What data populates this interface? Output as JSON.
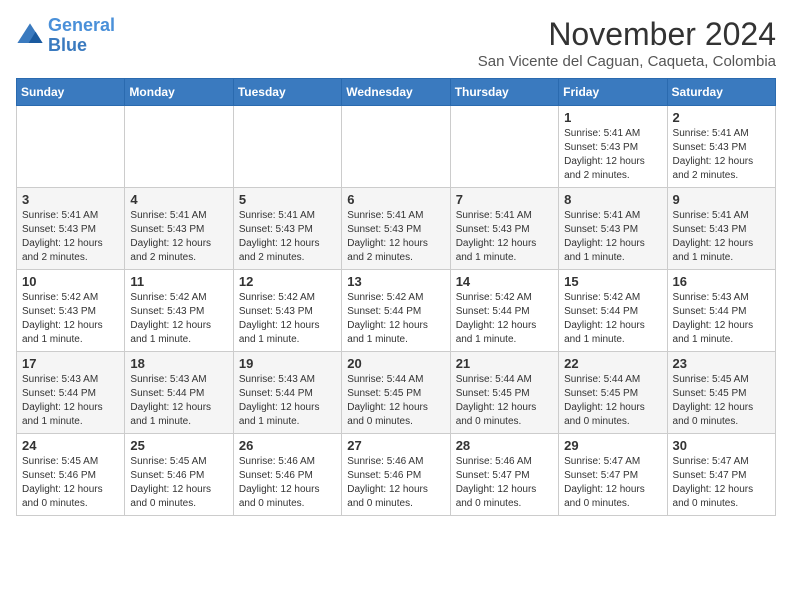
{
  "logo": {
    "line1": "General",
    "line2": "Blue"
  },
  "title": "November 2024",
  "location": "San Vicente del Caguan, Caqueta, Colombia",
  "weekdays": [
    "Sunday",
    "Monday",
    "Tuesday",
    "Wednesday",
    "Thursday",
    "Friday",
    "Saturday"
  ],
  "weeks": [
    [
      {
        "day": "",
        "info": ""
      },
      {
        "day": "",
        "info": ""
      },
      {
        "day": "",
        "info": ""
      },
      {
        "day": "",
        "info": ""
      },
      {
        "day": "",
        "info": ""
      },
      {
        "day": "1",
        "info": "Sunrise: 5:41 AM\nSunset: 5:43 PM\nDaylight: 12 hours and 2 minutes."
      },
      {
        "day": "2",
        "info": "Sunrise: 5:41 AM\nSunset: 5:43 PM\nDaylight: 12 hours and 2 minutes."
      }
    ],
    [
      {
        "day": "3",
        "info": "Sunrise: 5:41 AM\nSunset: 5:43 PM\nDaylight: 12 hours and 2 minutes."
      },
      {
        "day": "4",
        "info": "Sunrise: 5:41 AM\nSunset: 5:43 PM\nDaylight: 12 hours and 2 minutes."
      },
      {
        "day": "5",
        "info": "Sunrise: 5:41 AM\nSunset: 5:43 PM\nDaylight: 12 hours and 2 minutes."
      },
      {
        "day": "6",
        "info": "Sunrise: 5:41 AM\nSunset: 5:43 PM\nDaylight: 12 hours and 2 minutes."
      },
      {
        "day": "7",
        "info": "Sunrise: 5:41 AM\nSunset: 5:43 PM\nDaylight: 12 hours and 1 minute."
      },
      {
        "day": "8",
        "info": "Sunrise: 5:41 AM\nSunset: 5:43 PM\nDaylight: 12 hours and 1 minute."
      },
      {
        "day": "9",
        "info": "Sunrise: 5:41 AM\nSunset: 5:43 PM\nDaylight: 12 hours and 1 minute."
      }
    ],
    [
      {
        "day": "10",
        "info": "Sunrise: 5:42 AM\nSunset: 5:43 PM\nDaylight: 12 hours and 1 minute."
      },
      {
        "day": "11",
        "info": "Sunrise: 5:42 AM\nSunset: 5:43 PM\nDaylight: 12 hours and 1 minute."
      },
      {
        "day": "12",
        "info": "Sunrise: 5:42 AM\nSunset: 5:43 PM\nDaylight: 12 hours and 1 minute."
      },
      {
        "day": "13",
        "info": "Sunrise: 5:42 AM\nSunset: 5:44 PM\nDaylight: 12 hours and 1 minute."
      },
      {
        "day": "14",
        "info": "Sunrise: 5:42 AM\nSunset: 5:44 PM\nDaylight: 12 hours and 1 minute."
      },
      {
        "day": "15",
        "info": "Sunrise: 5:42 AM\nSunset: 5:44 PM\nDaylight: 12 hours and 1 minute."
      },
      {
        "day": "16",
        "info": "Sunrise: 5:43 AM\nSunset: 5:44 PM\nDaylight: 12 hours and 1 minute."
      }
    ],
    [
      {
        "day": "17",
        "info": "Sunrise: 5:43 AM\nSunset: 5:44 PM\nDaylight: 12 hours and 1 minute."
      },
      {
        "day": "18",
        "info": "Sunrise: 5:43 AM\nSunset: 5:44 PM\nDaylight: 12 hours and 1 minute."
      },
      {
        "day": "19",
        "info": "Sunrise: 5:43 AM\nSunset: 5:44 PM\nDaylight: 12 hours and 1 minute."
      },
      {
        "day": "20",
        "info": "Sunrise: 5:44 AM\nSunset: 5:45 PM\nDaylight: 12 hours and 0 minutes."
      },
      {
        "day": "21",
        "info": "Sunrise: 5:44 AM\nSunset: 5:45 PM\nDaylight: 12 hours and 0 minutes."
      },
      {
        "day": "22",
        "info": "Sunrise: 5:44 AM\nSunset: 5:45 PM\nDaylight: 12 hours and 0 minutes."
      },
      {
        "day": "23",
        "info": "Sunrise: 5:45 AM\nSunset: 5:45 PM\nDaylight: 12 hours and 0 minutes."
      }
    ],
    [
      {
        "day": "24",
        "info": "Sunrise: 5:45 AM\nSunset: 5:46 PM\nDaylight: 12 hours and 0 minutes."
      },
      {
        "day": "25",
        "info": "Sunrise: 5:45 AM\nSunset: 5:46 PM\nDaylight: 12 hours and 0 minutes."
      },
      {
        "day": "26",
        "info": "Sunrise: 5:46 AM\nSunset: 5:46 PM\nDaylight: 12 hours and 0 minutes."
      },
      {
        "day": "27",
        "info": "Sunrise: 5:46 AM\nSunset: 5:46 PM\nDaylight: 12 hours and 0 minutes."
      },
      {
        "day": "28",
        "info": "Sunrise: 5:46 AM\nSunset: 5:47 PM\nDaylight: 12 hours and 0 minutes."
      },
      {
        "day": "29",
        "info": "Sunrise: 5:47 AM\nSunset: 5:47 PM\nDaylight: 12 hours and 0 minutes."
      },
      {
        "day": "30",
        "info": "Sunrise: 5:47 AM\nSunset: 5:47 PM\nDaylight: 12 hours and 0 minutes."
      }
    ]
  ]
}
